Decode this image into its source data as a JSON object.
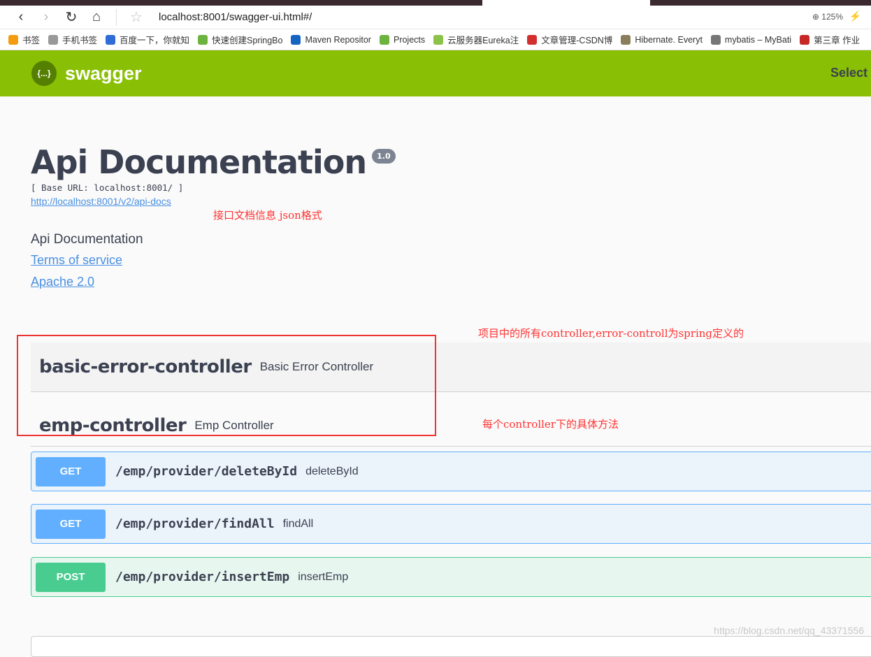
{
  "browser": {
    "url": "localhost:8001/swagger-ui.html#/",
    "zoom": "125%",
    "bookmarks": [
      {
        "label": "书签",
        "color": "#f39c12"
      },
      {
        "label": "手机书签",
        "color": "#999999"
      },
      {
        "label": "百度一下，你就知",
        "color": "#2f6cd8"
      },
      {
        "label": "快速创建SpringBo",
        "color": "#6db33f"
      },
      {
        "label": "Maven Repositor",
        "color": "#1565c0"
      },
      {
        "label": "Projects",
        "color": "#6db33f"
      },
      {
        "label": "云服务器Eureka注",
        "color": "#8bc34a"
      },
      {
        "label": "文章管理-CSDN博",
        "color": "#d32f2f"
      },
      {
        "label": "Hibernate. Everyt",
        "color": "#8a7f5a"
      },
      {
        "label": "mybatis – MyBati",
        "color": "#777777"
      },
      {
        "label": "第三章 作业",
        "color": "#c62828"
      }
    ]
  },
  "header": {
    "brand": "swagger",
    "logo_text": "{...}",
    "select": "Select a"
  },
  "info": {
    "title": "Api Documentation",
    "version": "1.0",
    "base_url": "[ Base URL: localhost:8001/ ]",
    "api_docs_link": "http://localhost:8001/v2/api-docs",
    "description": "Api Documentation",
    "terms": "Terms of service",
    "license": "Apache 2.0"
  },
  "annotations": {
    "json": "接口文档信息 json格式",
    "controllers": "项目中的所有controller,error-controll为spring定义的",
    "controllers2": "controller",
    "methods": "每个controller下的具体方法"
  },
  "tags": [
    {
      "name": "basic-error-controller",
      "desc": "Basic Error Controller"
    },
    {
      "name": "emp-controller",
      "desc": "Emp Controller"
    }
  ],
  "operations": [
    {
      "method": "GET",
      "path": "/emp/provider/deleteById",
      "summary": "deleteById"
    },
    {
      "method": "GET",
      "path": "/emp/provider/findAll",
      "summary": "findAll"
    },
    {
      "method": "POST",
      "path": "/emp/provider/insertEmp",
      "summary": "insertEmp"
    }
  ],
  "colors": {
    "header": "#89bf04",
    "get": "#61affe",
    "post": "#49cc90"
  },
  "watermark": "https://blog.csdn.net/qq_43371556"
}
